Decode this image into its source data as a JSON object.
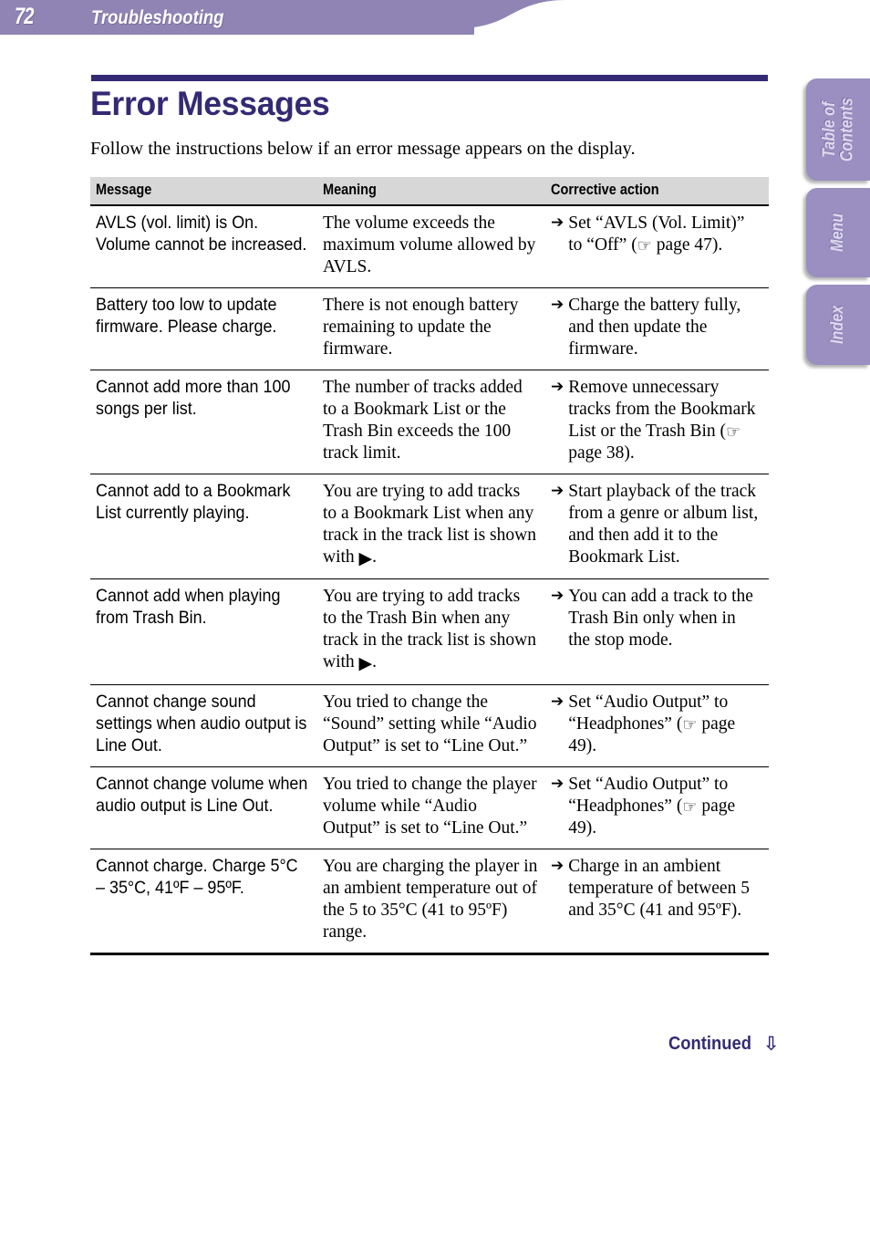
{
  "header": {
    "page_number": "72",
    "section_title": "Troubleshooting",
    "bar_color": "#8f84b3"
  },
  "side_tabs": [
    {
      "label": "Table of\nContents",
      "name": "table-of-contents"
    },
    {
      "label": "Menu",
      "name": "menu"
    },
    {
      "label": "Index",
      "name": "index"
    }
  ],
  "page": {
    "title": "Error Messages",
    "title_color": "#342a73",
    "intro": "Follow the instructions below if an error message appears on the display."
  },
  "table": {
    "columns": [
      "Message",
      "Meaning",
      "Corrective action"
    ],
    "rows": [
      {
        "message": "AVLS (vol. limit) is On. Volume cannot be increased.",
        "meaning": "The volume exceeds the maximum volume allowed by AVLS.",
        "action_arrow": "➔",
        "action": "Set “AVLS (Vol. Limit)” to “Off” (☞ page 47)."
      },
      {
        "message": "Battery too low to update firmware. Please charge.",
        "meaning": "There is not enough battery remaining to update the firmware.",
        "action_arrow": "➔",
        "action": "Charge the battery fully, and then update the firmware."
      },
      {
        "message": "Cannot add more than 100 songs per list.",
        "meaning": "The number of tracks added to a Bookmark List or the Trash Bin exceeds the 100 track limit.",
        "action_arrow": "➔",
        "action": "Remove unnecessary tracks from the Bookmark List or the Trash Bin (☞ page 38)."
      },
      {
        "message": "Cannot add to a Bookmark List currently playing.",
        "meaning": "You are trying to add tracks to a Bookmark List when any track in the track list is shown with ▶⓿.",
        "action_arrow": "➔",
        "action": "Start playback of the track from a genre or album list, and then add it to the Bookmark List."
      },
      {
        "message": "Cannot add when playing from Trash Bin.",
        "meaning": "You are trying to add tracks to the Trash Bin when any track in the track list is shown with ▶⓿.",
        "action_arrow": "➔",
        "action": "You can add a track to the Trash Bin only when in the stop mode."
      },
      {
        "message": "Cannot change sound settings when audio output is Line Out.",
        "meaning": "You tried to change the “Sound” setting while “Audio Output” is set to “Line Out.”",
        "action_arrow": "➔",
        "action": "Set “Audio Output” to “Headphones” (☞ page 49)."
      },
      {
        "message": "Cannot change volume when audio output is Line Out.",
        "meaning": "You tried to change the player volume while “Audio Output” is set to “Line Out.”",
        "action_arrow": "➔",
        "action": "Set “Audio Output” to “Headphones” (☞ page 49)."
      },
      {
        "message": "Cannot charge. Charge 5°C – 35°C, 41ºF – 95ºF.",
        "meaning": "You are charging the player in an ambient temperature out of the 5 to 35°C (41 to 95ºF) range.",
        "action_arrow": "➔",
        "action": "Charge in an ambient temperature of between 5 and 35°C (41 and 95ºF)."
      }
    ]
  },
  "footer": {
    "continued_label": "Continued",
    "continued_arrow": "⇩"
  }
}
